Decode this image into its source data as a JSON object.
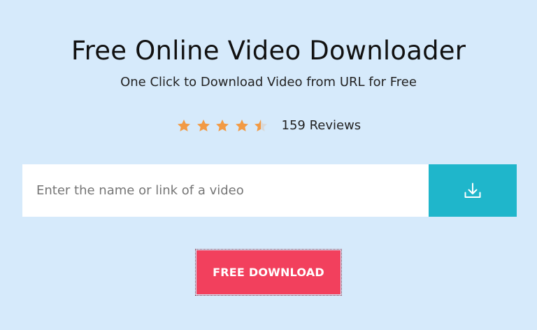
{
  "hero": {
    "title": "Free Online Video Downloader",
    "subtitle": "One Click to Download Video from URL for Free"
  },
  "rating": {
    "value": 4.5,
    "max": 5,
    "reviews_label": "159 Reviews",
    "star_color": "#f29a44",
    "empty_star_color": "#d9d9d9"
  },
  "search": {
    "placeholder": "Enter the name or link of a video",
    "value": "",
    "button_icon": "download-tray-icon",
    "button_color": "#1fb6cb"
  },
  "cta": {
    "label": "FREE DOWNLOAD",
    "color": "#f2405d"
  }
}
